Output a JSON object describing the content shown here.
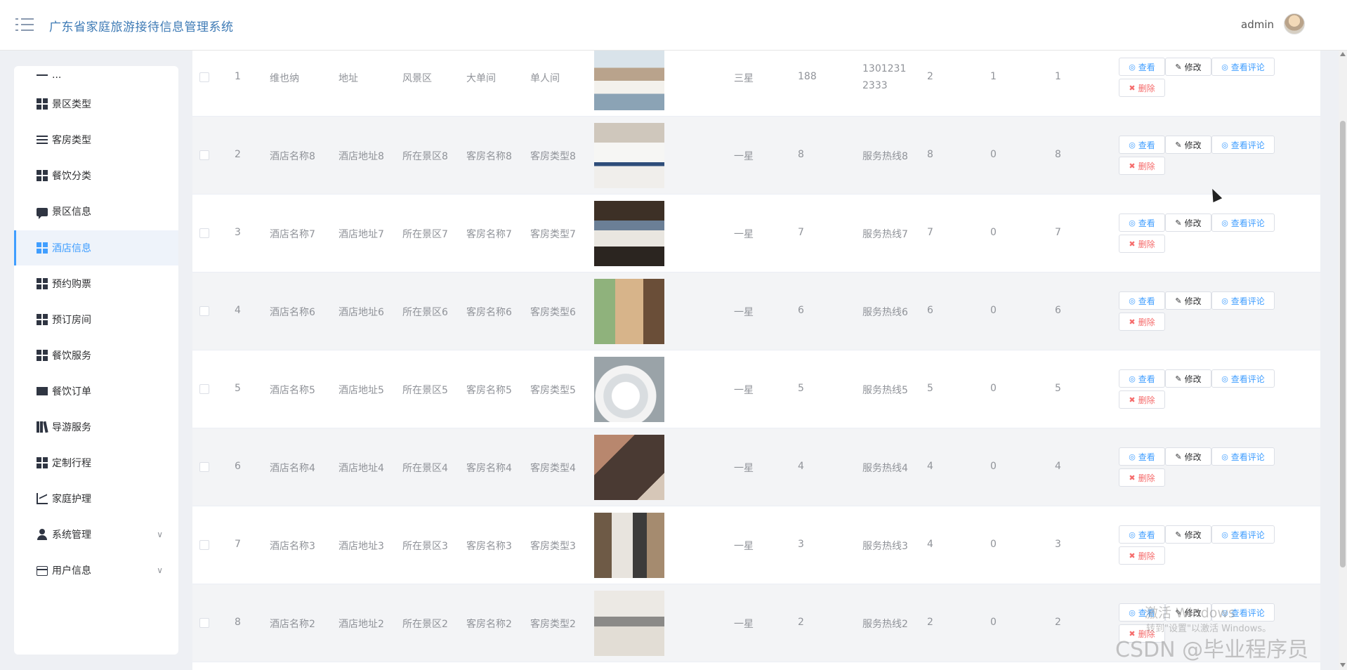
{
  "header": {
    "title": "广东省家庭旅游接待信息管理系统",
    "username": "admin"
  },
  "sidebar": {
    "items": [
      {
        "label": "...",
        "icon": "dash-icon"
      },
      {
        "label": "景区类型",
        "icon": "grid-icon"
      },
      {
        "label": "客房类型",
        "icon": "list-icon"
      },
      {
        "label": "餐饮分类",
        "icon": "grid-icon"
      },
      {
        "label": "景区信息",
        "icon": "chat-icon"
      },
      {
        "label": "酒店信息",
        "icon": "grid-icon",
        "active": true
      },
      {
        "label": "预约购票",
        "icon": "grid-icon"
      },
      {
        "label": "预订房间",
        "icon": "grid-icon"
      },
      {
        "label": "餐饮服务",
        "icon": "grid-icon"
      },
      {
        "label": "餐饮订单",
        "icon": "monitor-icon"
      },
      {
        "label": "导游服务",
        "icon": "book-icon"
      },
      {
        "label": "定制行程",
        "icon": "grid-icon"
      },
      {
        "label": "家庭护理",
        "icon": "chart-icon"
      },
      {
        "label": "系统管理",
        "icon": "user-icon",
        "expandable": true
      },
      {
        "label": "用户信息",
        "icon": "card-icon",
        "expandable": true
      }
    ]
  },
  "actions": {
    "view": "查看",
    "edit": "修改",
    "comments": "查看评论",
    "delete": "删除"
  },
  "table": {
    "rows": [
      {
        "index": "1",
        "name": "维也纳",
        "address": "地址",
        "scenic": "风景区",
        "room": "大单间",
        "room_type": "单人间",
        "star": "三星",
        "price": "188",
        "hotline": "13012312333",
        "c1": "2",
        "c2": "1",
        "c3": "1",
        "image": "hotel-room-1"
      },
      {
        "index": "2",
        "name": "酒店名称8",
        "address": "酒店地址8",
        "scenic": "所在景区8",
        "room": "客房名称8",
        "room_type": "客房类型8",
        "star": "一星",
        "price": "8",
        "hotline": "服务热线8",
        "c1": "8",
        "c2": "0",
        "c3": "8",
        "image": "hotel-room-2"
      },
      {
        "index": "3",
        "name": "酒店名称7",
        "address": "酒店地址7",
        "scenic": "所在景区7",
        "room": "客房名称7",
        "room_type": "客房类型7",
        "star": "一星",
        "price": "7",
        "hotline": "服务热线7",
        "c1": "7",
        "c2": "0",
        "c3": "7",
        "image": "hotel-room-3"
      },
      {
        "index": "4",
        "name": "酒店名称6",
        "address": "酒店地址6",
        "scenic": "所在景区6",
        "room": "客房名称6",
        "room_type": "客房类型6",
        "star": "一星",
        "price": "6",
        "hotline": "服务热线6",
        "c1": "6",
        "c2": "0",
        "c3": "6",
        "image": "hotel-room-4"
      },
      {
        "index": "5",
        "name": "酒店名称5",
        "address": "酒店地址5",
        "scenic": "所在景区5",
        "room": "客房名称5",
        "room_type": "客房类型5",
        "star": "一星",
        "price": "5",
        "hotline": "服务热线5",
        "c1": "5",
        "c2": "0",
        "c3": "5",
        "image": "tableware"
      },
      {
        "index": "6",
        "name": "酒店名称4",
        "address": "酒店地址4",
        "scenic": "所在景区4",
        "room": "客房名称4",
        "room_type": "客房类型4",
        "star": "一星",
        "price": "4",
        "hotline": "服务热线4",
        "c1": "4",
        "c2": "0",
        "c3": "4",
        "image": "blanket"
      },
      {
        "index": "7",
        "name": "酒店名称3",
        "address": "酒店地址3",
        "scenic": "所在景区3",
        "room": "客房名称3",
        "room_type": "客房类型3",
        "star": "一星",
        "price": "3",
        "hotline": "服务热线3",
        "c1": "4",
        "c2": "0",
        "c3": "3",
        "image": "hotel-lobby"
      },
      {
        "index": "8",
        "name": "酒店名称2",
        "address": "酒店地址2",
        "scenic": "所在景区2",
        "room": "客房名称2",
        "room_type": "客房类型2",
        "star": "一星",
        "price": "2",
        "hotline": "服务热线2",
        "c1": "2",
        "c2": "0",
        "c3": "2",
        "image": "room-aerial"
      }
    ]
  },
  "watermarks": {
    "win_title": "激活 Windows",
    "win_sub": "转到\"设置\"以激活 Windows。",
    "csdn": "CSDN @毕业程序员"
  },
  "colors": {
    "accent": "#409eff",
    "danger": "#f56c6c",
    "title": "#3d7ab5"
  }
}
